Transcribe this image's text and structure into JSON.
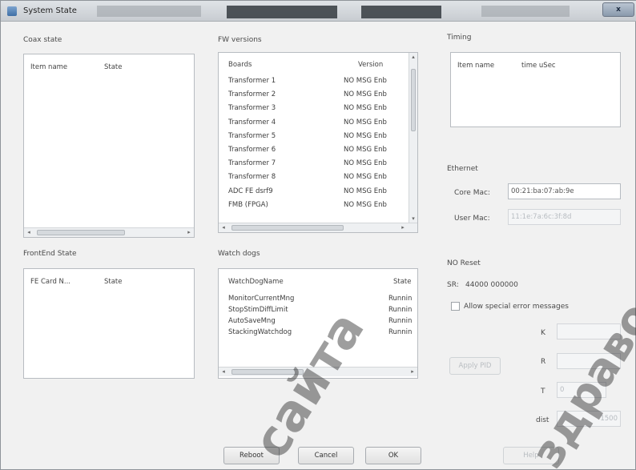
{
  "window": {
    "title": "System State",
    "close_label": "x"
  },
  "coax": {
    "title": "Coax state",
    "columns": [
      "Item name",
      "State"
    ],
    "rows": []
  },
  "fw": {
    "title": "FW versions",
    "columns": [
      "Boards",
      "Version"
    ],
    "rows": [
      {
        "board": "Transformer 1",
        "version": "NO MSG Enb"
      },
      {
        "board": "Transformer 2",
        "version": "NO MSG Enb"
      },
      {
        "board": "Transformer 3",
        "version": "NO MSG Enb"
      },
      {
        "board": "Transformer 4",
        "version": "NO MSG Enb"
      },
      {
        "board": "Transformer 5",
        "version": "NO MSG Enb"
      },
      {
        "board": "Transformer 6",
        "version": "NO MSG Enb"
      },
      {
        "board": "Transformer 7",
        "version": "NO MSG Enb"
      },
      {
        "board": "Transformer 8",
        "version": "NO MSG Enb"
      },
      {
        "board": "ADC FE dsrf9",
        "version": "NO MSG Enb"
      },
      {
        "board": "FMB (FPGA)",
        "version": "NO MSG Enb"
      }
    ]
  },
  "timing": {
    "title": "Timing",
    "columns": [
      "Item name",
      "time uSec"
    ]
  },
  "ethernet": {
    "title": "Ethernet",
    "core_mac_label": "Core Mac:",
    "core_mac_value": "00:21:ba:07:ab:9e",
    "user_mac_label": "User Mac:",
    "user_mac_value": "11:1e:7a:6c:3f:8d"
  },
  "frontend": {
    "title": "FrontEnd State",
    "columns": [
      "FE Card N...",
      "State"
    ]
  },
  "watchdogs": {
    "title": "Watch dogs",
    "columns": [
      "WatchDogName",
      "State"
    ],
    "rows": [
      {
        "name": "MonitorCurrentMng",
        "state": "Runnin"
      },
      {
        "name": "StopStimDiffLimit",
        "state": "Runnin"
      },
      {
        "name": "AutoSaveMng",
        "state": "Runnin"
      },
      {
        "name": "StackingWatchdog",
        "state": "Runnin"
      }
    ]
  },
  "no_reset": {
    "title": "NO Reset",
    "sr_label": "SR:",
    "sr_value": "44000 000000",
    "allow_label": "Allow special error messages",
    "apply_pid_label": "Apply PID",
    "k_label": "K",
    "r_label": "R",
    "t_label": "T",
    "t_value": "0",
    "dist_label": "dist",
    "dist_value": "1500"
  },
  "buttons": {
    "reboot": "Reboot",
    "cancel": "Cancel",
    "ok": "OK",
    "help": "Help"
  },
  "watermark": {
    "line1": "сайта",
    "line2": "здравое"
  }
}
